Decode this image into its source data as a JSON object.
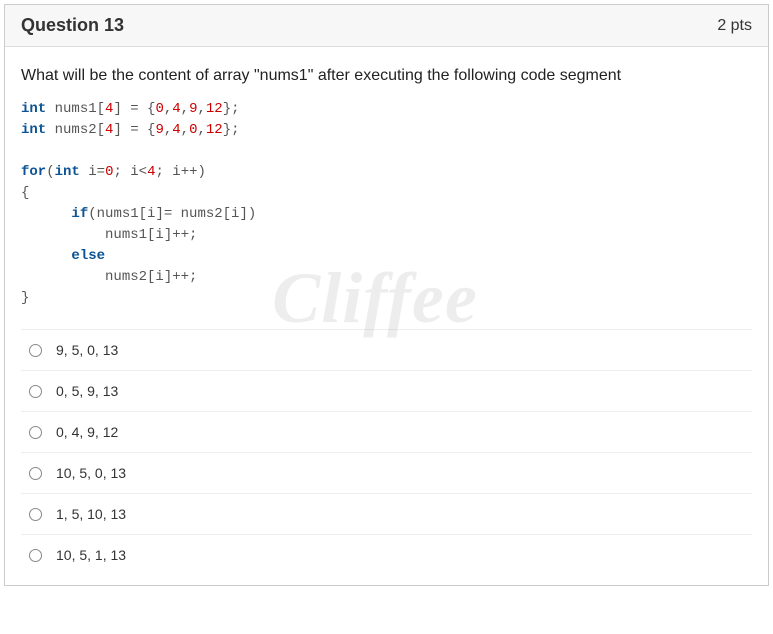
{
  "header": {
    "title": "Question 13",
    "points": "2 pts"
  },
  "question": {
    "prompt": "What will be the content of array \"nums1\" after executing the following code segment",
    "code": {
      "l1a": "int",
      "l1b": " nums1[",
      "l1c": "4",
      "l1d": "] = {",
      "l1e": "0",
      "l1f": ",",
      "l1g": "4",
      "l1h": ",",
      "l1i": "9",
      "l1j": ",",
      "l1k": "12",
      "l1l": "};",
      "l2a": "int",
      "l2b": " nums2[",
      "l2c": "4",
      "l2d": "] = {",
      "l2e": "9",
      "l2f": ",",
      "l2g": "4",
      "l2h": ",",
      "l2i": "0",
      "l2j": ",",
      "l2k": "12",
      "l2l": "};",
      "blank": "",
      "l3a": "for",
      "l3b": "(",
      "l3c": "int",
      "l3d": " i=",
      "l3e": "0",
      "l3f": "; i<",
      "l3g": "4",
      "l3h": "; i++)",
      "l4": "{",
      "l5a": "      ",
      "l5b": "if",
      "l5c": "(nums1[i]= nums2[i])",
      "l6": "          nums1[i]++;",
      "l7a": "      ",
      "l7b": "else",
      "l8": "          nums2[i]++;",
      "l9": "}"
    }
  },
  "options": [
    {
      "label": "9, 5, 0, 13"
    },
    {
      "label": "0, 5, 9, 13"
    },
    {
      "label": "0, 4, 9, 12"
    },
    {
      "label": "10, 5, 0, 13"
    },
    {
      "label": "1, 5, 10, 13"
    },
    {
      "label": "10, 5, 1, 13"
    }
  ],
  "watermark": {
    "text": "Cliffee"
  }
}
